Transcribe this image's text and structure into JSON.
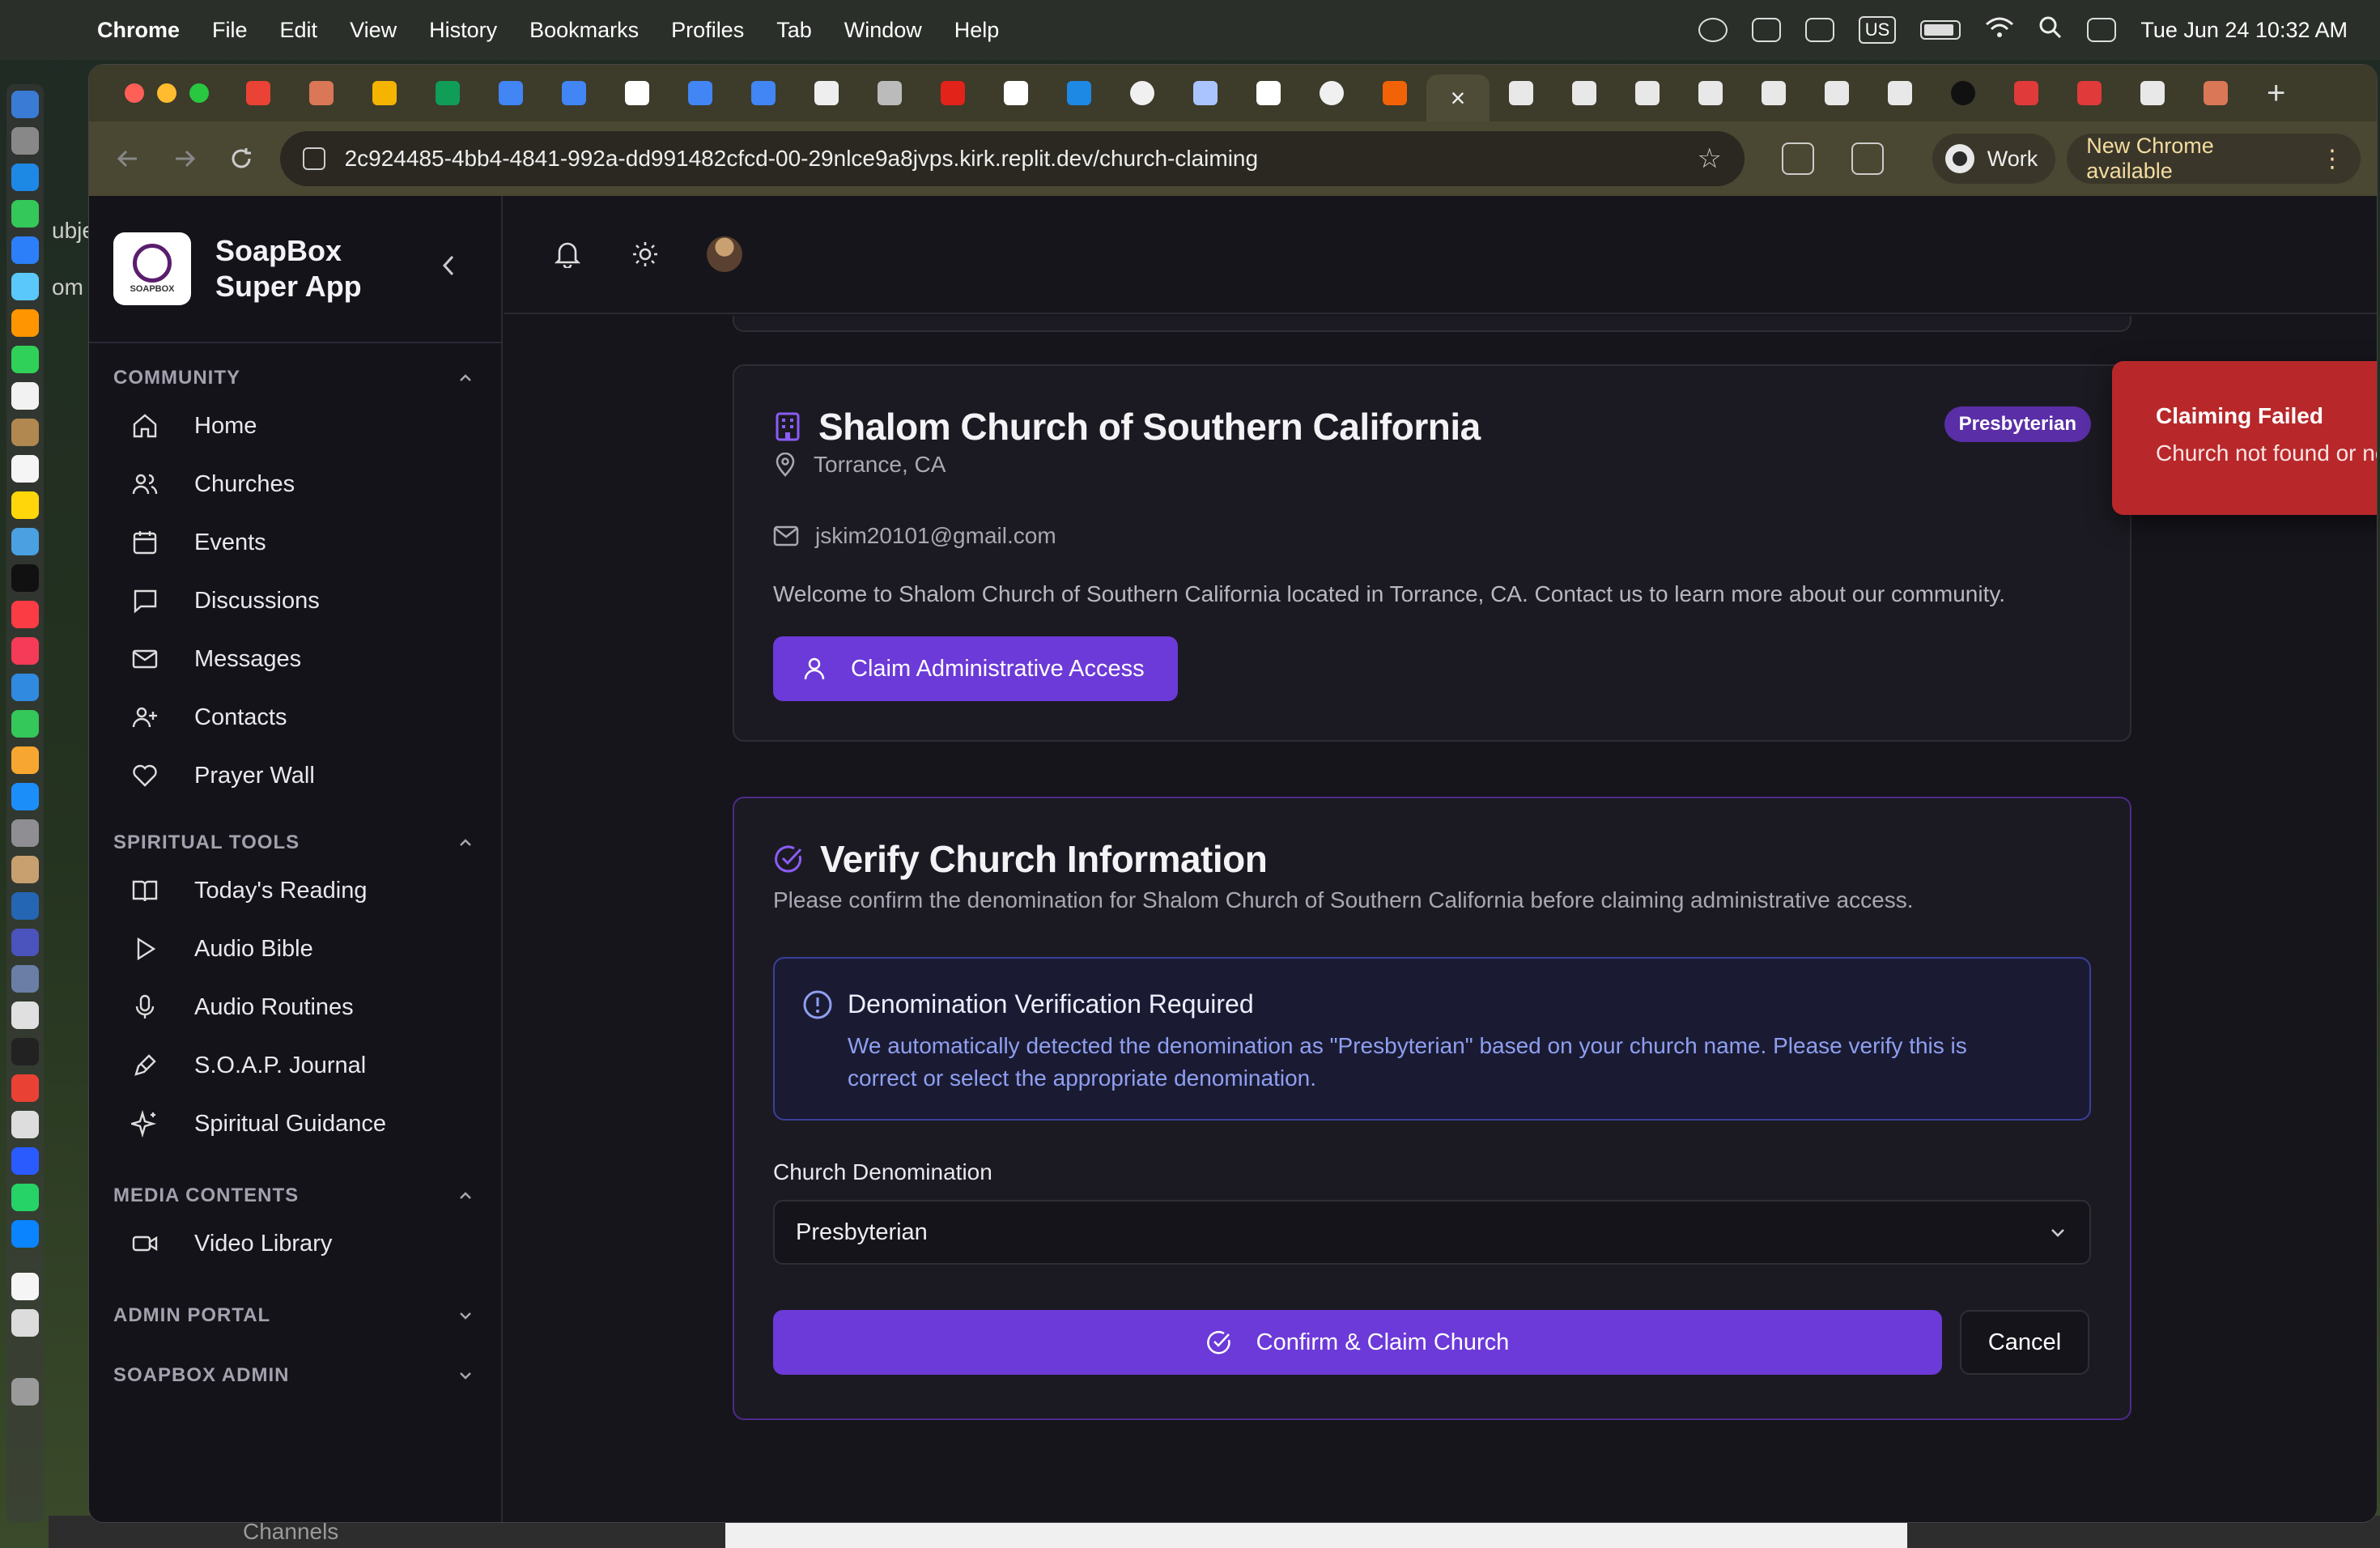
{
  "menubar": {
    "app": "Chrome",
    "items": [
      "File",
      "Edit",
      "View",
      "History",
      "Bookmarks",
      "Profiles",
      "Tab",
      "Window",
      "Help"
    ],
    "input_source": "US",
    "clock": "Tue Jun 24  10:32 AM"
  },
  "desktop": {
    "left_fragments": [
      "ubje",
      "om"
    ],
    "bottom_text": "Channels"
  },
  "browser": {
    "url": "2c924485-4bb4-4841-992a-dd991482cfcd-00-29nlce9a8jvps.kirk.replit.dev/church-claiming",
    "profile": "Work",
    "update_label": "New Chrome available",
    "tab_favicons": [
      "gmail",
      "claude",
      "drive",
      "sheets",
      "docs",
      "docs",
      "google",
      "app",
      "docs",
      "openai",
      "globe",
      "acrobat",
      "google",
      "safari",
      "github",
      "car",
      "google",
      "github",
      "replit",
      "active-close",
      "soapbox",
      "soapbox",
      "soapbox",
      "soapbox",
      "soapbox",
      "soapbox",
      "soapbox",
      "x",
      "target",
      "target",
      "soapbox",
      "claude"
    ]
  },
  "sidebar": {
    "brand": "SoapBox Super App",
    "logo_text": "SOAPBOX",
    "sections": [
      {
        "title": "COMMUNITY",
        "items": [
          {
            "label": "Home",
            "icon": "home-icon"
          },
          {
            "label": "Churches",
            "icon": "users-icon"
          },
          {
            "label": "Events",
            "icon": "calendar-icon"
          },
          {
            "label": "Discussions",
            "icon": "chat-icon"
          },
          {
            "label": "Messages",
            "icon": "mail-icon"
          },
          {
            "label": "Contacts",
            "icon": "user-plus-icon"
          },
          {
            "label": "Prayer Wall",
            "icon": "heart-icon"
          }
        ]
      },
      {
        "title": "SPIRITUAL TOOLS",
        "items": [
          {
            "label": "Today's Reading",
            "icon": "book-icon"
          },
          {
            "label": "Audio Bible",
            "icon": "play-icon"
          },
          {
            "label": "Audio Routines",
            "icon": "mic-icon"
          },
          {
            "label": "S.O.A.P. Journal",
            "icon": "pen-icon"
          },
          {
            "label": "Spiritual Guidance",
            "icon": "sparkles-icon"
          }
        ]
      },
      {
        "title": "MEDIA CONTENTS",
        "items": [
          {
            "label": "Video Library",
            "icon": "video-icon"
          }
        ]
      },
      {
        "title": "ADMIN PORTAL",
        "items": []
      },
      {
        "title": "SOAPBOX ADMIN",
        "items": []
      }
    ]
  },
  "church": {
    "name": "Shalom Church of Southern California",
    "denomination_badge": "Presbyterian",
    "location": "Torrance, CA",
    "email": "jskim20101@gmail.com",
    "welcome": "Welcome to Shalom Church of Southern California located in Torrance, CA. Contact us to learn more about our community.",
    "claim_button": "Claim Administrative Access"
  },
  "verify": {
    "title": "Verify Church Information",
    "description": "Please confirm the denomination for Shalom Church of Southern California before claiming administrative access.",
    "alert_title": "Denomination Verification Required",
    "alert_body": "We automatically detected the denomination as \"Presbyterian\" based on your church name. Please verify this is correct or select the appropriate denomination.",
    "field_label": "Church Denomination",
    "selected": "Presbyterian",
    "confirm_button": "Confirm & Claim Church",
    "cancel_button": "Cancel"
  },
  "toast": {
    "title": "Claiming Failed",
    "message": "Church not found or not claimable by this user"
  },
  "colors": {
    "accent": "#6c3ad8",
    "toast": "#b8282a",
    "badge": "#5a2ea6",
    "alert_text": "#8f9ff0"
  }
}
